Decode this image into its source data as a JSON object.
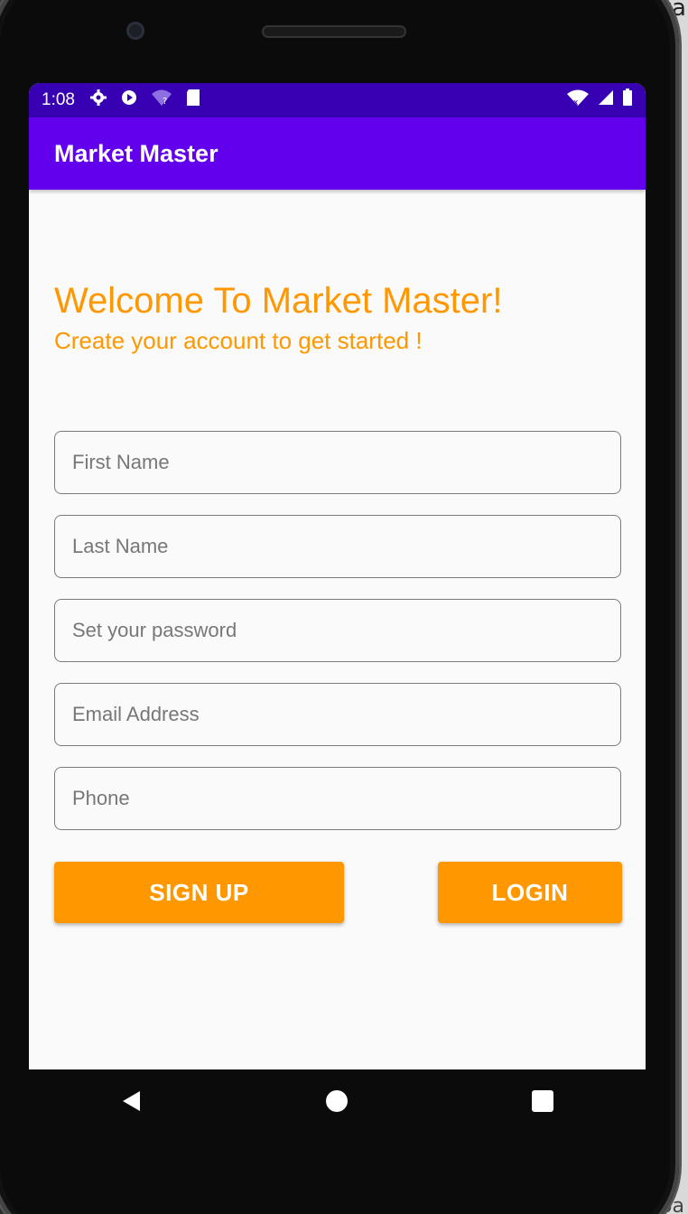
{
  "desktop": {
    "top_right_text": "va",
    "bottom_right_text": "spa"
  },
  "status_bar": {
    "time": "1:08",
    "icons": [
      "settings-icon",
      "shield-icon",
      "wifi-question-icon",
      "sd-card-icon"
    ],
    "right_icons": [
      "wifi-off-icon",
      "signal-icon",
      "battery-icon"
    ]
  },
  "app_bar": {
    "title": "Market Master"
  },
  "main": {
    "welcome": "Welcome To Market Master!",
    "subtitle": "Create your account to get started !",
    "fields": {
      "first_name": {
        "placeholder": "First Name",
        "value": ""
      },
      "last_name": {
        "placeholder": "Last Name",
        "value": ""
      },
      "password": {
        "placeholder": "Set your password",
        "value": ""
      },
      "email": {
        "placeholder": "Email Address",
        "value": ""
      },
      "phone": {
        "placeholder": "Phone",
        "value": ""
      }
    },
    "buttons": {
      "signup": "SIGN UP",
      "login": "LOGIN"
    }
  },
  "nav_bar": {
    "icons": [
      "back-icon",
      "home-icon",
      "recents-icon"
    ]
  },
  "colors": {
    "status_bar": "#3700b3",
    "app_bar": "#6200ee",
    "accent": "#ff9800",
    "background": "#fafafa"
  }
}
